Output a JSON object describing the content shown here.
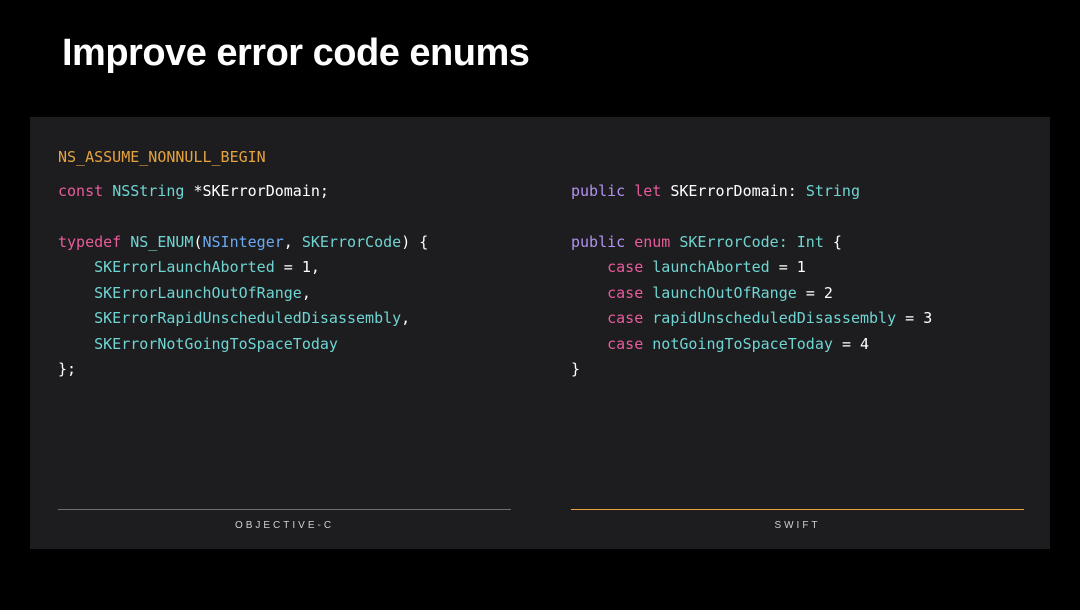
{
  "title": "Improve error code enums",
  "preamble": {
    "macro": "NS_ASSUME_NONNULL_BEGIN"
  },
  "left": {
    "footer": "OBJECTIVE-C",
    "kw_const": "const",
    "type_nsstring": "NSString",
    "domain_decl": " *SKErrorDomain;",
    "kw_typedef": "typedef",
    "ns_enum": "NS_ENUM",
    "paren_open": "(",
    "ns_integer": "NSInteger",
    "comma": ", ",
    "enum_name": "SKErrorCode",
    "paren_close_brace": ") {",
    "cases": [
      "SKErrorLaunchAborted",
      "SKErrorLaunchOutOfRange",
      "SKErrorRapidUnscheduledDisassembly",
      "SKErrorNotGoingToSpaceToday"
    ],
    "case0_suffix": " = 1,",
    "comma_suffix": ",",
    "close": "};"
  },
  "right": {
    "footer": "SWIFT",
    "kw_public": "public",
    "kw_let": "let",
    "domain_name": " SKErrorDomain: ",
    "type_string": "String",
    "kw_enum": "enum",
    "enum_name": " SKErrorCode: ",
    "type_int": "Int",
    "brace_open": " {",
    "kw_case": "case",
    "cases": [
      {
        "name": " launchAborted ",
        "eq": "= 1"
      },
      {
        "name": " launchOutOfRange ",
        "eq": "= 2"
      },
      {
        "name": " rapidUnscheduledDisassembly ",
        "eq": "= 3"
      },
      {
        "name": " notGoingToSpaceToday ",
        "eq": "= 4"
      }
    ],
    "close": "}"
  }
}
